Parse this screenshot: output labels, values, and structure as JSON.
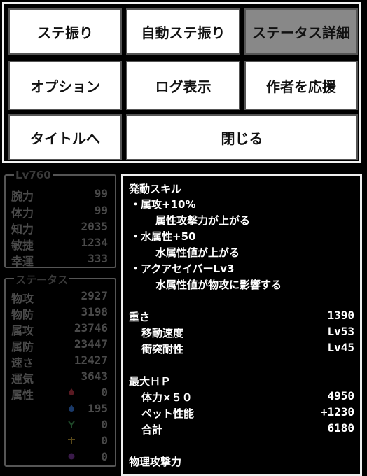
{
  "menu": {
    "buttons": [
      {
        "label": "ステ振り"
      },
      {
        "label": "自動ステ振り"
      },
      {
        "label": "ステータス詳細"
      },
      {
        "label": "オプション"
      },
      {
        "label": "ログ表示"
      },
      {
        "label": "作者を応援"
      },
      {
        "label": "タイトルへ"
      },
      {
        "label": "閉じる"
      }
    ]
  },
  "base_stats": {
    "title": "Lv760",
    "rows": [
      {
        "label": "腕力",
        "value": "99"
      },
      {
        "label": "体力",
        "value": "99"
      },
      {
        "label": "知力",
        "value": "2035"
      },
      {
        "label": "敏捷",
        "value": "1234"
      },
      {
        "label": "幸運",
        "value": "333"
      }
    ]
  },
  "status": {
    "title": "ステータス",
    "rows": [
      {
        "label": "物攻",
        "value": "2927"
      },
      {
        "label": "物防",
        "value": "3198"
      },
      {
        "label": "属攻",
        "value": "23746"
      },
      {
        "label": "属防",
        "value": "23447"
      },
      {
        "label": "速さ",
        "value": "12427"
      },
      {
        "label": "運気",
        "value": "3643"
      }
    ],
    "attribute_label": "属性",
    "attributes": [
      {
        "icon": "fire-icon",
        "color": "#5a1a22",
        "value": "0"
      },
      {
        "icon": "water-icon",
        "color": "#1a3a6a",
        "value": "195"
      },
      {
        "icon": "wind-icon",
        "color": "#1f4a2a",
        "value": "0"
      },
      {
        "icon": "earth-icon",
        "color": "#5a4a1a",
        "value": "0"
      },
      {
        "icon": "dark-icon",
        "color": "#3a1a4a",
        "value": "0"
      }
    ]
  },
  "detail": {
    "skills_heading": "発動スキル",
    "skills": [
      {
        "name": "・属攻+10%",
        "desc": "属性攻撃力が上がる"
      },
      {
        "name": "・水属性+50",
        "desc": "水属性値が上がる"
      },
      {
        "name": "・アクアセイバーLv3",
        "desc": "水属性値が物攻に影響する"
      }
    ],
    "weight": {
      "label": "重さ",
      "value": "1390"
    },
    "move_speed": {
      "label": "移動速度",
      "value": "Lv53"
    },
    "impact": {
      "label": "衝突耐性",
      "value": "Lv45"
    },
    "max_hp_heading": "最大ＨＰ",
    "hp_rows": [
      {
        "label": "体力×５０",
        "value": "4950"
      },
      {
        "label": "ペット性能",
        "value": "+1230"
      },
      {
        "label": "合計",
        "value": "6180"
      }
    ],
    "phys_attack_heading": "物理攻撃力"
  }
}
